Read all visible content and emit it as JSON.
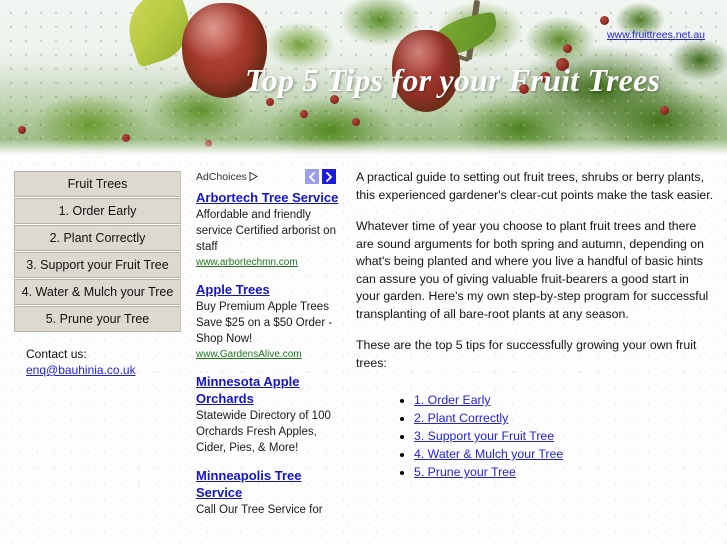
{
  "header": {
    "title": "Top 5 Tips for your Fruit Trees",
    "site_url": "www.fruittrees.net.au"
  },
  "sidebar": {
    "items": [
      {
        "label": "Fruit Trees"
      },
      {
        "label": "1. Order Early"
      },
      {
        "label": "2. Plant Correctly"
      },
      {
        "label": "3. Support your Fruit Tree"
      },
      {
        "label": "4. Water & Mulch your Tree"
      },
      {
        "label": "5. Prune your Tree"
      }
    ],
    "contact_label": "Contact us:",
    "contact_email": "enq@bauhinia.co.uk"
  },
  "ads": {
    "adchoices_label": "AdChoices",
    "prev_arrow": "chevron-left-icon",
    "next_arrow": "chevron-right-icon",
    "items": [
      {
        "title": "Arbortech Tree Service",
        "description": "Affordable and friendly service Certified arborist on staff",
        "url": "www.arbortechmn.com"
      },
      {
        "title": "Apple Trees",
        "description": "Buy Premium Apple Trees Save $25 on a $50 Order - Shop Now!",
        "url": "www.GardensAlive.com"
      },
      {
        "title": "Minnesota Apple Orchards",
        "description": "Statewide Directory of 100 Orchards Fresh Apples, Cider, Pies, & More!",
        "url": ""
      },
      {
        "title": "Minneapolis Tree Service",
        "description": "Call Our Tree Service for",
        "url": ""
      }
    ]
  },
  "article": {
    "paragraphs": [
      "A practical guide to setting out fruit trees, shrubs or berry plants, this experienced gardener's clear-cut points make the task easier.",
      "Whatever time of year you choose to plant fruit trees and there are sound arguments for both spring and autumn, depending on what's being planted and where you live a handful of basic hints can assure you of giving valuable fruit-bearers a good start in your garden. Here's my own step-by-step program for successful transplanting of all bare-root plants at any season.",
      "These are the top 5 tips for successfully growing your own fruit trees:"
    ],
    "tips": [
      {
        "label": "1. Order Early"
      },
      {
        "label": "2. Plant Correctly"
      },
      {
        "label": "3. Support your Fruit Tree"
      },
      {
        "label": "4. Water & Mulch your Tree"
      },
      {
        "label": "5. Prune your Tree"
      }
    ]
  },
  "colors": {
    "link": "#2222dd",
    "ad_title": "#1414cc",
    "ad_url": "#1a7a1a",
    "nav_button_bg": "#ded9d0",
    "arrow_next_bg": "#1a1ae0",
    "arrow_prev_bg": "#9aa0e8"
  }
}
